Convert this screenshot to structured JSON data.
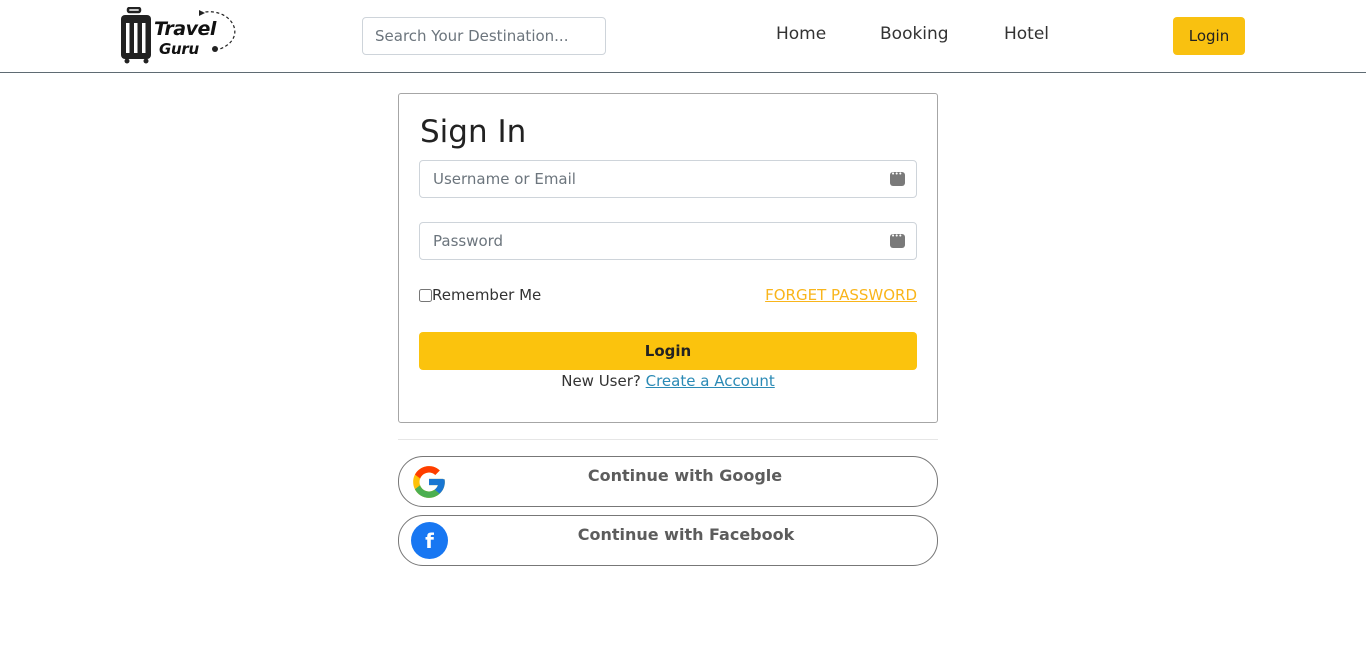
{
  "header": {
    "logo_line1": "Travel",
    "logo_line2": "Guru",
    "search_placeholder": "Search Your Destination...",
    "nav": {
      "home": "Home",
      "booking": "Booking",
      "hotel": "Hotel"
    },
    "login_label": "Login"
  },
  "signin": {
    "title": "Sign In",
    "username_placeholder": "Username or Email",
    "password_placeholder": "Password",
    "remember_label": "Remember Me",
    "forget_label": "FORGET PASSWORD",
    "login_label": "Login",
    "new_user_text": "New User? ",
    "create_account_label": "Create a Account"
  },
  "social": {
    "google_label": "Continue with Google",
    "facebook_label": "Continue with Facebook",
    "facebook_glyph": "f"
  },
  "colors": {
    "accent": "#fbc30d",
    "link": "#2b8ab5",
    "forget": "#f9b51b",
    "facebook": "#1877f2"
  }
}
